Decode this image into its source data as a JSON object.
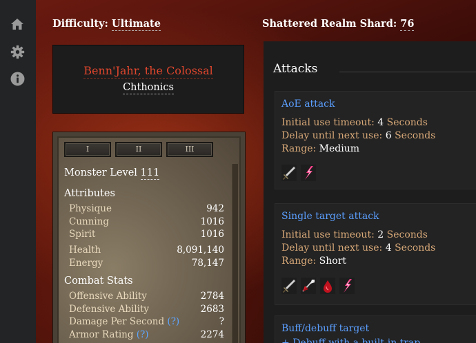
{
  "sidebar": {
    "items": [
      {
        "icon": "home-icon"
      },
      {
        "icon": "gear-icon"
      },
      {
        "icon": "info-icon"
      }
    ]
  },
  "header": {
    "difficulty_label": "Difficulty:",
    "difficulty_value": "Ultimate",
    "shard_label": "Shattered Realm Shard:",
    "shard_value": "76"
  },
  "monster": {
    "name": "Benn'Jahr, the Colossal",
    "type": "Chthonics"
  },
  "tabs": [
    "I",
    "II",
    "III"
  ],
  "stats": {
    "level_label": "Monster Level",
    "level_value": "111",
    "attributes_heading": "Attributes",
    "attributes": [
      {
        "label": "Physique",
        "value": "942"
      },
      {
        "label": "Cunning",
        "value": "1016"
      },
      {
        "label": "Spirit",
        "value": "1016"
      }
    ],
    "resources": [
      {
        "label": "Health",
        "value": "8,091,140"
      },
      {
        "label": "Energy",
        "value": "78,147"
      }
    ],
    "combat_heading": "Combat Stats",
    "combat": [
      {
        "label": "Offensive Ability",
        "help": "",
        "value": "2784"
      },
      {
        "label": "Defensive Ability",
        "help": "",
        "value": "2683"
      },
      {
        "label": "Damage Per Second",
        "help": "(?)",
        "value": "?"
      },
      {
        "label": "Armor Rating",
        "help": "(?)",
        "value": "2274"
      }
    ]
  },
  "attacks": {
    "heading": "Attacks",
    "cards": [
      {
        "title": "AoE attack",
        "lines": [
          {
            "label": "Initial use timeout:",
            "value": "4",
            "suffix": "Seconds"
          },
          {
            "label": "Delay until next use:",
            "value": "6",
            "suffix": "Seconds"
          },
          {
            "label": "Range:",
            "value": "Medium",
            "suffix": ""
          }
        ],
        "icons": [
          "sword-icon",
          "lightning-icon"
        ]
      },
      {
        "title": "Single target attack",
        "lines": [
          {
            "label": "Initial use timeout:",
            "value": "2",
            "suffix": "Seconds"
          },
          {
            "label": "Delay until next use:",
            "value": "4",
            "suffix": "Seconds"
          },
          {
            "label": "Range:",
            "value": "Short",
            "suffix": ""
          }
        ],
        "icons": [
          "sword-icon",
          "arrow-strike-icon",
          "blood-drop-icon",
          "lightning-icon"
        ]
      },
      {
        "title": "Buff/debuff target",
        "lines": [
          {
            "label": "Debuff with a built-in trap",
            "value": "",
            "suffix": ""
          }
        ],
        "icons": []
      }
    ]
  },
  "colors": {
    "accent_blue": "#5b9fff",
    "monster_red": "#e0462d",
    "label_tan": "#d7a878"
  }
}
